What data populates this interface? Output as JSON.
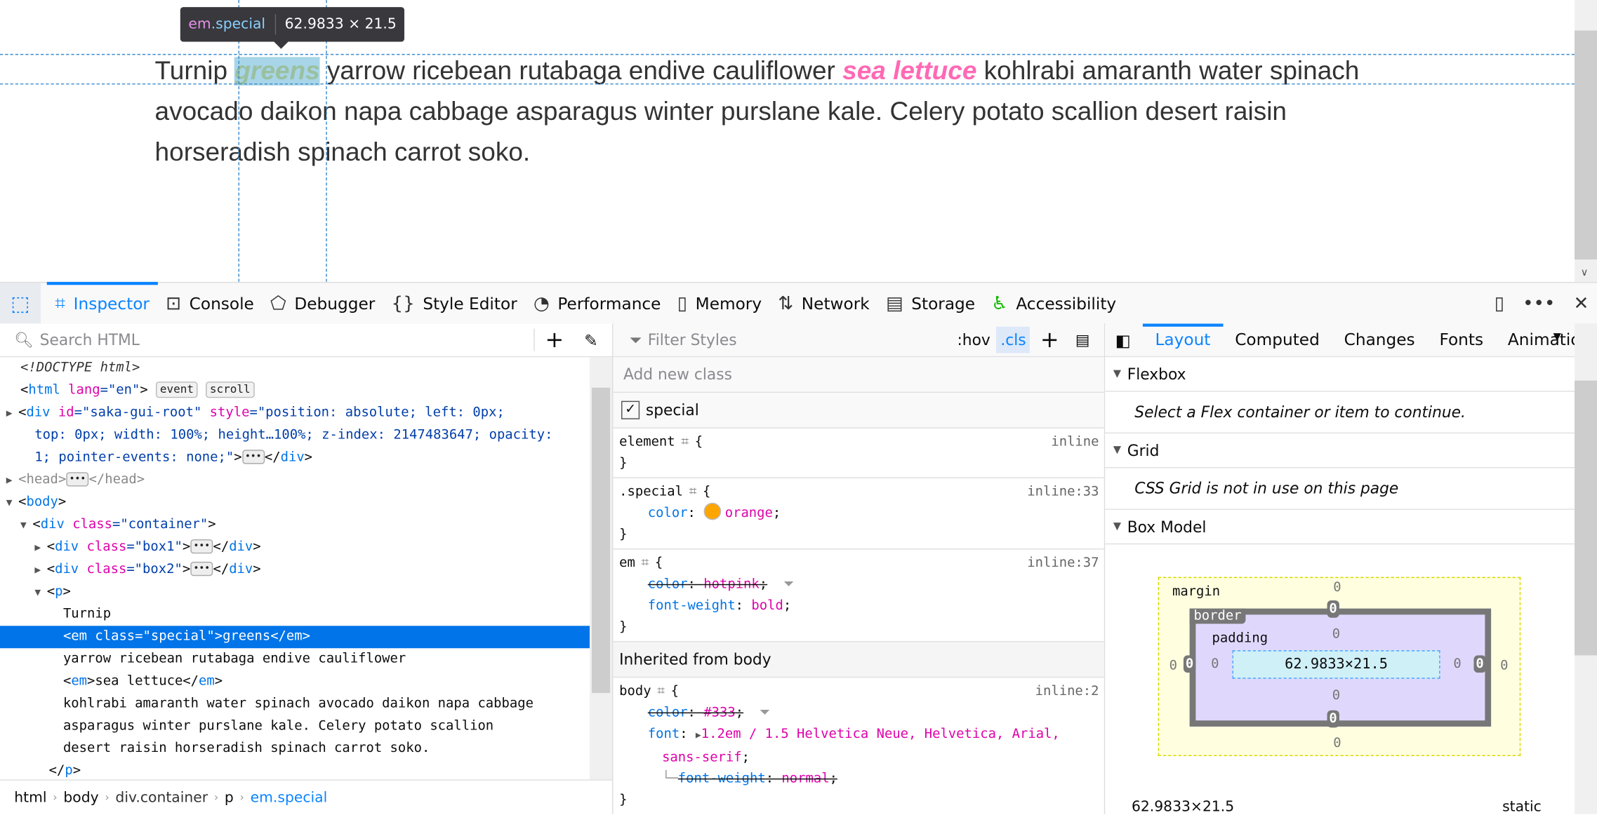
{
  "page": {
    "text_before": "Turnip ",
    "em_special": "greens",
    "text_mid": " yarrow ricebean rutabaga endive cauliflower ",
    "em_plain": "sea lettuce",
    "text_after": " kohlrabi amaranth water spinach avocado daikon napa cabbage asparagus winter purslane kale. Celery potato scallion desert raisin horseradish spinach carrot soko.",
    "tooltip": {
      "tag": "em",
      "cls": ".special",
      "size": "62.9833 × 21.5"
    }
  },
  "toolbar": {
    "tabs": [
      {
        "label": "Inspector",
        "icon": "inspector-icon",
        "glyph": "⌗",
        "selected": true
      },
      {
        "label": "Console",
        "icon": "console-icon",
        "glyph": "⊡"
      },
      {
        "label": "Debugger",
        "icon": "debugger-icon",
        "glyph": "⬠"
      },
      {
        "label": "Style Editor",
        "icon": "style-editor-icon",
        "glyph": "{}"
      },
      {
        "label": "Performance",
        "icon": "performance-icon",
        "glyph": "◔"
      },
      {
        "label": "Memory",
        "icon": "memory-icon",
        "glyph": "▯"
      },
      {
        "label": "Network",
        "icon": "network-icon",
        "glyph": "⇅"
      },
      {
        "label": "Storage",
        "icon": "storage-icon",
        "glyph": "▤"
      },
      {
        "label": "Accessibility",
        "icon": "accessibility-icon",
        "glyph": "♿"
      }
    ]
  },
  "markup": {
    "search_placeholder": "Search HTML",
    "tree": [
      {
        "indent": 0,
        "tw": "",
        "tokens": [
          {
            "t": "<!DOCTYPE html>",
            "c": "dt"
          }
        ]
      },
      {
        "indent": 0,
        "tw": "",
        "tokens": [
          {
            "t": "<",
            "c": "tx"
          },
          {
            "t": "html",
            "c": "tg"
          },
          {
            "t": " lang",
            "c": "an"
          },
          {
            "t": "=\"en\"",
            "c": "av"
          },
          {
            "t": ">",
            "c": "tx"
          },
          {
            "t": " ",
            "c": "tx"
          },
          {
            "t": "event",
            "c": "badge"
          },
          {
            "t": " ",
            "c": "tx"
          },
          {
            "t": "scroll",
            "c": "badge"
          }
        ]
      },
      {
        "indent": 0,
        "tw": "▶",
        "tokens": [
          {
            "t": "<",
            "c": "tx"
          },
          {
            "t": "div",
            "c": "tg"
          },
          {
            "t": " id",
            "c": "an"
          },
          {
            "t": "=\"saka-gui-root\"",
            "c": "av"
          },
          {
            "t": " style",
            "c": "an"
          },
          {
            "t": "=\"position: absolute; left: 0px;",
            "c": "av"
          }
        ]
      },
      {
        "indent": 1,
        "tw": "",
        "tokens": [
          {
            "t": "top: 0px; width: 100%; height…100%; z-index: 2147483647; opacity:",
            "c": "av"
          }
        ]
      },
      {
        "indent": 1,
        "tw": "",
        "tokens": [
          {
            "t": "1; pointer-events: none;\"",
            "c": "av"
          },
          {
            "t": ">",
            "c": "tx"
          },
          {
            "t": "•••",
            "c": "dots"
          },
          {
            "t": "</",
            "c": "tx"
          },
          {
            "t": "div",
            "c": "tg"
          },
          {
            "t": ">",
            "c": "tx"
          }
        ]
      },
      {
        "indent": 0,
        "tw": "▶",
        "tokens": [
          {
            "t": "<head>",
            "c": "dim"
          },
          {
            "t": "•••",
            "c": "dots"
          },
          {
            "t": "</head>",
            "c": "dim"
          }
        ]
      },
      {
        "indent": 0,
        "tw": "▼",
        "tokens": [
          {
            "t": "<",
            "c": "tx"
          },
          {
            "t": "body",
            "c": "tg"
          },
          {
            "t": ">",
            "c": "tx"
          }
        ]
      },
      {
        "indent": 1,
        "tw": "▼",
        "tokens": [
          {
            "t": "<",
            "c": "tx"
          },
          {
            "t": "div",
            "c": "tg"
          },
          {
            "t": " class",
            "c": "an"
          },
          {
            "t": "=\"container\"",
            "c": "av"
          },
          {
            "t": ">",
            "c": "tx"
          }
        ]
      },
      {
        "indent": 2,
        "tw": "▶",
        "tokens": [
          {
            "t": "<",
            "c": "tx"
          },
          {
            "t": "div",
            "c": "tg"
          },
          {
            "t": " class",
            "c": "an"
          },
          {
            "t": "=\"box1\"",
            "c": "av"
          },
          {
            "t": ">",
            "c": "tx"
          },
          {
            "t": "•••",
            "c": "dots"
          },
          {
            "t": "</",
            "c": "tx"
          },
          {
            "t": "div",
            "c": "tg"
          },
          {
            "t": ">",
            "c": "tx"
          }
        ]
      },
      {
        "indent": 2,
        "tw": "▶",
        "tokens": [
          {
            "t": "<",
            "c": "tx"
          },
          {
            "t": "div",
            "c": "tg"
          },
          {
            "t": " class",
            "c": "an"
          },
          {
            "t": "=\"box2\"",
            "c": "av"
          },
          {
            "t": ">",
            "c": "tx"
          },
          {
            "t": "•••",
            "c": "dots"
          },
          {
            "t": "</",
            "c": "tx"
          },
          {
            "t": "div",
            "c": "tg"
          },
          {
            "t": ">",
            "c": "tx"
          }
        ]
      },
      {
        "indent": 2,
        "tw": "▼",
        "tokens": [
          {
            "t": "<",
            "c": "tx"
          },
          {
            "t": "p",
            "c": "tg"
          },
          {
            "t": ">",
            "c": "tx"
          }
        ]
      },
      {
        "indent": 3,
        "tw": "",
        "tokens": [
          {
            "t": "Turnip",
            "c": "tx"
          }
        ]
      },
      {
        "indent": 3,
        "tw": "",
        "selected": true,
        "tokens": [
          {
            "t": "<em class=\"special\">greens</em>",
            "c": "tx"
          }
        ]
      },
      {
        "indent": 3,
        "tw": "",
        "tokens": [
          {
            "t": "yarrow ricebean rutabaga endive cauliflower",
            "c": "tx"
          }
        ]
      },
      {
        "indent": 3,
        "tw": "",
        "tokens": [
          {
            "t": "<",
            "c": "tx"
          },
          {
            "t": "em",
            "c": "tg"
          },
          {
            "t": ">",
            "c": "tx"
          },
          {
            "t": "sea lettuce",
            "c": "tx"
          },
          {
            "t": "</",
            "c": "tx"
          },
          {
            "t": "em",
            "c": "tg"
          },
          {
            "t": ">",
            "c": "tx"
          }
        ]
      },
      {
        "indent": 3,
        "tw": "",
        "tokens": [
          {
            "t": "kohlrabi amaranth water spinach avocado daikon napa cabbage",
            "c": "tx"
          }
        ]
      },
      {
        "indent": 3,
        "tw": "",
        "tokens": [
          {
            "t": "asparagus winter purslane kale. Celery potato scallion",
            "c": "tx"
          }
        ]
      },
      {
        "indent": 3,
        "tw": "",
        "tokens": [
          {
            "t": "desert raisin horseradish spinach carrot soko.",
            "c": "tx"
          }
        ]
      },
      {
        "indent": 2,
        "tw": "",
        "tokens": [
          {
            "t": "</",
            "c": "tx"
          },
          {
            "t": "p",
            "c": "tg"
          },
          {
            "t": ">",
            "c": "tx"
          }
        ]
      }
    ],
    "breadcrumbs": [
      "html",
      "body",
      "div.container",
      "p",
      "em.special"
    ]
  },
  "rules": {
    "filter_placeholder": "Filter Styles",
    "hov": ":hov",
    "cls": ".cls",
    "add_class_placeholder": "Add new class",
    "class_checkbox": {
      "label": "special",
      "checked": true
    },
    "element": {
      "selector": "element",
      "source": "inline"
    },
    "special": {
      "selector": ".special",
      "source": "inline:33",
      "prop": "color",
      "value": "orange",
      "swatch": "#ffa500"
    },
    "em": {
      "selector": "em",
      "source": "inline:37",
      "p1": "color",
      "v1": "hotpink",
      "p2": "font-weight",
      "v2": "bold"
    },
    "inherited_label": "Inherited from body",
    "body": {
      "selector": "body",
      "source": "inline:2",
      "p1": "color",
      "v1": "#333",
      "p2": "font",
      "v2a": "1.2em / 1.5 Helvetica Neue, Helvetica, Arial,",
      "v2b": "sans-serif",
      "p3": "font-weight",
      "v3": "normal"
    }
  },
  "layout": {
    "tabs": [
      "Layout",
      "Computed",
      "Changes",
      "Fonts",
      "Animatio"
    ],
    "flexbox": {
      "title": "Flexbox",
      "msg": "Select a Flex container or item to continue."
    },
    "grid": {
      "title": "Grid",
      "msg": "CSS Grid is not in use on this page"
    },
    "boxmodel": {
      "title": "Box Model",
      "margin_label": "margin",
      "border_label": "border",
      "padding_label": "padding",
      "content": "62.9833×21.5",
      "zero": "0",
      "size": "62.9833×21.5",
      "position": "static"
    }
  }
}
